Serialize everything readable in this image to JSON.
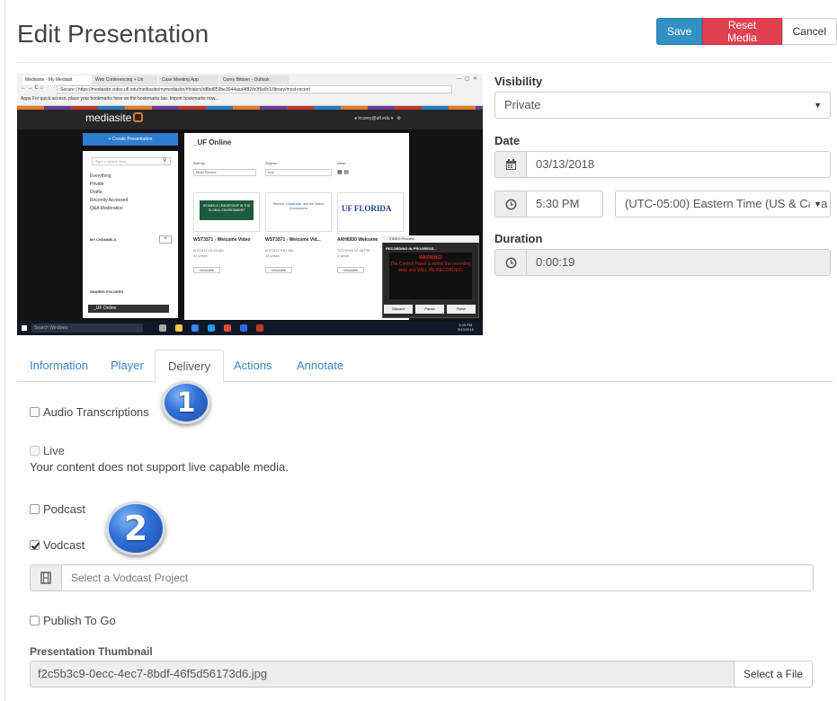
{
  "page": {
    "title": "Edit Presentation"
  },
  "toolbar": {
    "save_label": "Save",
    "reset_label": "Reset Media",
    "cancel_label": "Cancel"
  },
  "screenshot": {
    "browser_tabs": [
      "Mediasite - My Mediasit",
      "Web Conferencing + Un",
      "Case Meeting App",
      "Corey Bittsen - Outlook"
    ],
    "url": "https://mediasite.video.ufl.edu/mediasite/mymediasite/#folders/d8bd859be3044aad4f82/b0f6e8c1/library/most-recent",
    "url_secure_label": "Secure",
    "bookmarks_text": "Apps   For quick access, place your bookmarks here on the bookmarks bar. Import bookmarks now...",
    "logo_text": "mediasite",
    "user_text": "lrcorey@ufl.edu",
    "create_button": "+ Create Presentation",
    "search_placeholder": "Type a search term",
    "side_items": [
      "Everything",
      "Private",
      "Drafts",
      "Recently Accessed",
      "Q&A Moderation"
    ],
    "my_channels_label": "MY CHANNELS",
    "shared_folders_label": "SHARED FOLDERS",
    "active_folder": "_UF Online",
    "main_title": "_UF Online",
    "sort_label": "Sort by:",
    "sort_value": "Most Recent",
    "source_label": "Source:",
    "source_value": "Any",
    "view_label": "View:",
    "thumbs": [
      {
        "caption": "WST3371 - Welcome Video",
        "date": "8/1/2017 10:15 AM",
        "views": "61 views",
        "art": "WOMEN & LEADERSHIP IN THE GLOBAL ENVIRONMENT"
      },
      {
        "caption": "WST3371 - Welcome Vid...",
        "date": "8/7/2017 9:51 AM",
        "views": "33 views",
        "art": "Women, Leadership, and the Global Environment"
      },
      {
        "caption": "ARH6930 Welcome",
        "date": "7/22/2016 12:38 PM",
        "views": "4 views",
        "art": "UF FLORIDA"
      }
    ],
    "viewable_label": "Viewable",
    "recorder_title": "VIDEO Preview",
    "recorder_head": "RECORDING IN PROGRESS...",
    "recorder_warning": "WARNING!",
    "recorder_message": "The Control Panel is within the recording area and WILL BE RECORDED.",
    "recorder_buttons": [
      "Discard",
      "Pause",
      "Finish"
    ],
    "taskbar_search": "Search Windows",
    "clock_time": "5:29 PM",
    "clock_date": "3/13/2018"
  },
  "visibility": {
    "label": "Visibility",
    "value": "Private"
  },
  "date": {
    "label": "Date",
    "value": "03/13/2018",
    "time": "5:30 PM",
    "timezone": "(UTC-05:00) Eastern Time (US & Cana"
  },
  "duration": {
    "label": "Duration",
    "value": "0:00:19"
  },
  "tabs": [
    "Information",
    "Player",
    "Delivery",
    "Actions",
    "Annotate"
  ],
  "delivery": {
    "audio_transcriptions": "Audio Transcriptions",
    "live": "Live",
    "live_note": "Your content does not support live capable media.",
    "podcast": "Podcast",
    "vodcast": "Vodcast",
    "vodcast_placeholder": "Select a Vodcast Project",
    "publish_to_go": "Publish To Go",
    "thumbnail_label": "Presentation Thumbnail",
    "thumbnail_file": "f2c5b3c9-0ecc-4ec7-8bdf-46f5d56173d6.jpg",
    "select_file_label": "Select a File"
  },
  "markers": [
    "1",
    "2"
  ],
  "colors": {
    "save": "#3291c4",
    "reset": "#e04150",
    "link": "#3a87c4"
  }
}
